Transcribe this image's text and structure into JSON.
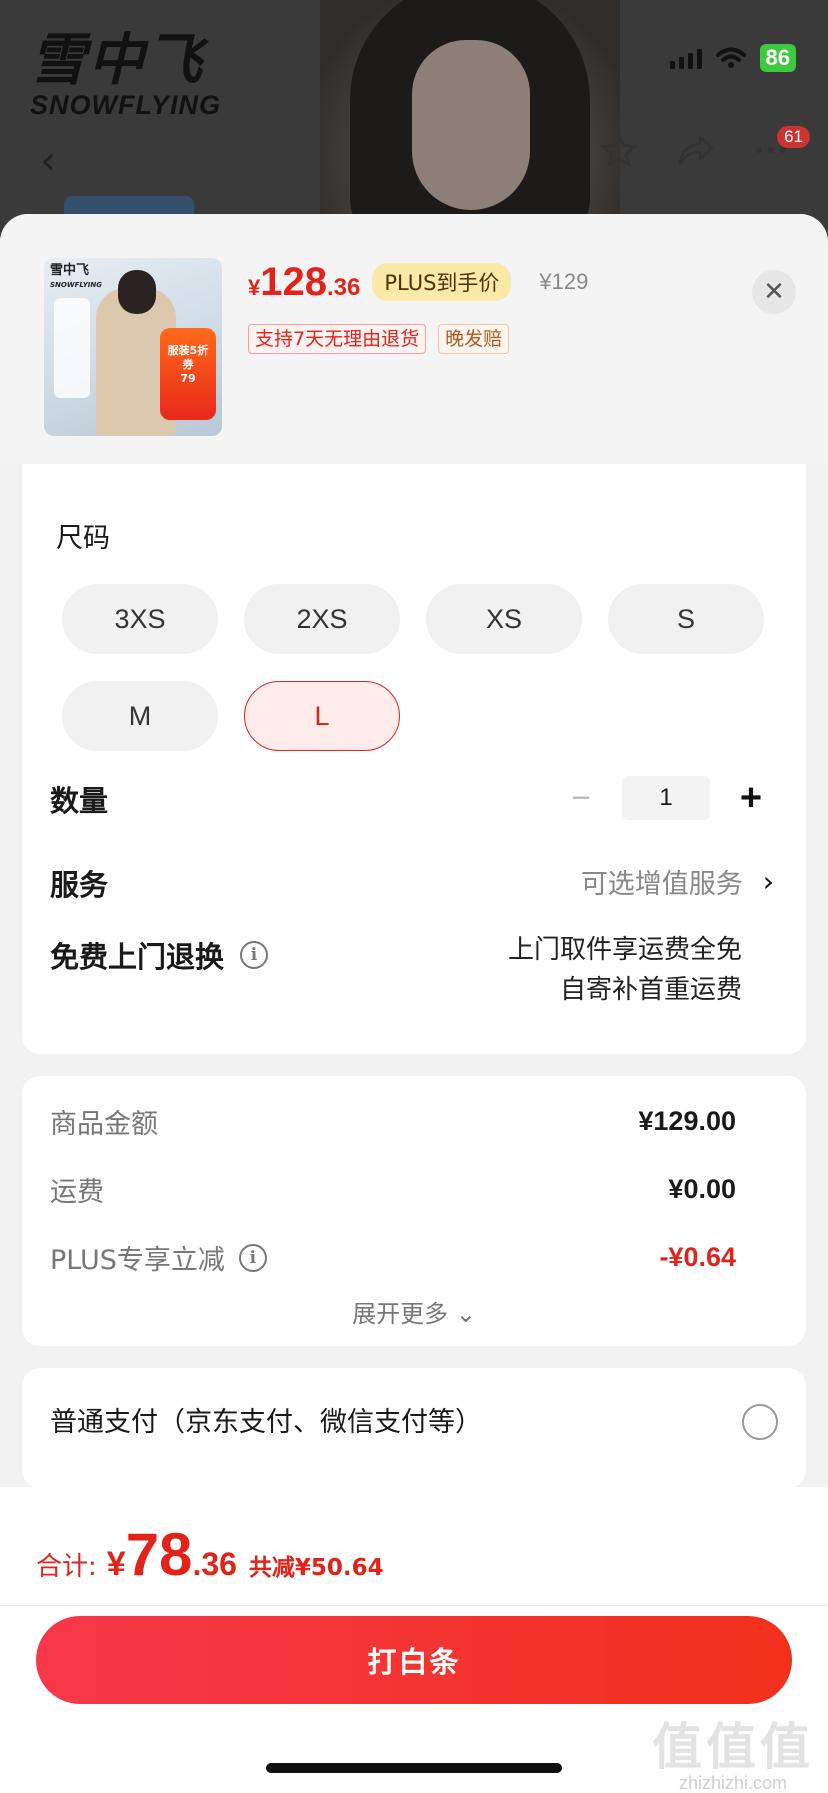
{
  "background": {
    "brand_cn": "雪中飞",
    "brand_en": "SNOWFLYING",
    "battery": "86",
    "badge_count": "61"
  },
  "product": {
    "price_symbol": "¥",
    "price_int": "128",
    "price_dec": ".36",
    "plus_tag": "PLUS到手价",
    "original_price": "¥129",
    "tags": [
      "支持7天无理由退货",
      "晚发赔"
    ],
    "thumb_logo_cn": "雪中飞",
    "thumb_logo_en": "SNOWFLYING",
    "thumb_promo": "服装5折券",
    "thumb_promo_value": "79"
  },
  "size": {
    "title": "尺码",
    "options": [
      "3XS",
      "2XS",
      "XS",
      "S",
      "M",
      "L"
    ],
    "selected": "L"
  },
  "quantity": {
    "label": "数量",
    "value": "1",
    "minus": "−",
    "plus": "+"
  },
  "service": {
    "label": "服务",
    "hint": "可选增值服务"
  },
  "free_return": {
    "label": "免费上门退换",
    "line1": "上门取件享运费全免",
    "line2": "自寄补首重运费"
  },
  "fees": {
    "goods_label": "商品金额",
    "goods_value": "¥129.00",
    "shipping_label": "运费",
    "shipping_value": "¥0.00",
    "plus_label": "PLUS专享立减",
    "plus_value": "-¥0.64",
    "expand": "展开更多"
  },
  "payment": {
    "option": "普通支付（京东支付、微信支付等）"
  },
  "footer": {
    "total_label": "合计:",
    "total_symbol": "¥",
    "total_int": "78",
    "total_dec": ".36",
    "total_save": "共减¥50.64",
    "pay_button": "打白条"
  },
  "watermark": {
    "cn": "值值值",
    "en": "zhizhizhi.com"
  },
  "colors": {
    "accent_red": "#e2231a",
    "plus_tag_bg": "#fbe9a8",
    "battery_green": "#3ec93e"
  }
}
